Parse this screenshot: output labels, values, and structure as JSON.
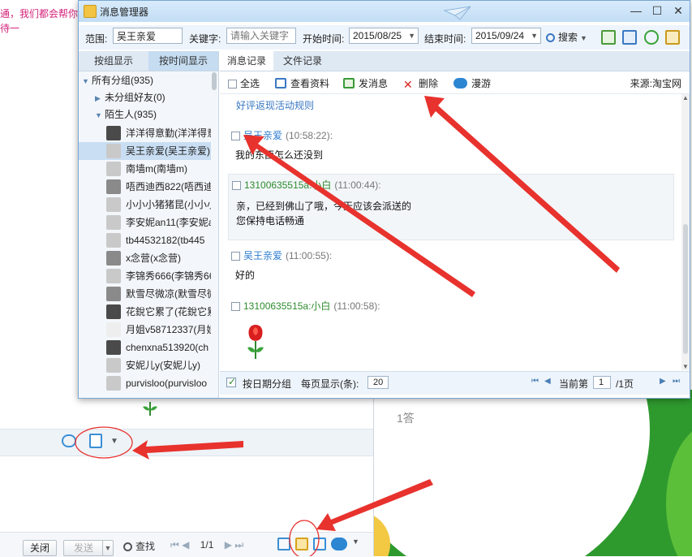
{
  "background": {
    "pink_lines": [
      "通，我们都会帮你",
      "待一"
    ],
    "close_label": "关闭",
    "send_label": "发送",
    "find_label": "查找",
    "pager_text": "1/1",
    "answer_count": "1答"
  },
  "window": {
    "title": "消息管理器"
  },
  "filter": {
    "range_label": "范围:",
    "range_value": "吴王亲爱",
    "keyword_label": "关键字:",
    "keyword_placeholder": "请输入关键字",
    "start_label": "开始时间:",
    "start_value": "2015/08/25",
    "end_label": "结束时间:",
    "end_value": "2015/09/24",
    "search_label": "搜索"
  },
  "left_tabs": [
    "按组显示",
    "按时间显示"
  ],
  "tree": {
    "all_groups": "所有分组(935)",
    "ungrouped": "未分组好友(0)",
    "strangers": "陌生人(935)",
    "contacts": [
      "洋洋得意勤(洋洋得意",
      "吴王亲爱(吴王亲爱)",
      "南墙m(南墙m)",
      "唔西迪西822(唔西迪",
      "小小小猪猪昆(小小小",
      "李安妮an11(李安妮a",
      "tb44532182(tb445",
      "x念营(x念营)",
      "李锦秀666(李锦秀66",
      "默雪尽微凉(默雪尽微",
      "花銳它累了(花銳它累",
      "月姐v58712337(月姐",
      "chenxna513920(ch",
      "安妮儿y(安妮儿y)",
      "purvisloo(purvisloo"
    ]
  },
  "right_tabs": [
    "消息记录",
    "文件记录"
  ],
  "actions": {
    "select_all": "全选",
    "view_profile": "查看资料",
    "send_message": "发消息",
    "delete": "删除",
    "roam": "漫游",
    "source": "来源:淘宝网"
  },
  "messages": {
    "rule_link": "好评返现活动规则",
    "items": [
      {
        "sender": "吴王亲爱",
        "time": "(10:58:22):",
        "lines": [
          "我的东西怎么还没到"
        ]
      },
      {
        "sender": "13100635515a:小白",
        "time": "(11:00:44):",
        "lines": [
          "亲，已经到佛山了哦，今天应该会派送的",
          "您保持电话畅通"
        ]
      },
      {
        "sender": "吴王亲爱",
        "time": "(11:00:55):",
        "lines": [
          "好的"
        ]
      },
      {
        "sender": "13100635515a:小白",
        "time": "(11:00:58):",
        "lines": []
      }
    ]
  },
  "footer": {
    "group_by_date": "按日期分组",
    "per_page_label": "每页显示(条):",
    "per_page_value": "20",
    "current_page_label": "当前第",
    "current_page_value": "1",
    "total_pages": "/1页"
  },
  "colors": {
    "accent_blue": "#3a78c2",
    "annotation_red": "#e8322d",
    "selected_row": "#c9def3"
  }
}
